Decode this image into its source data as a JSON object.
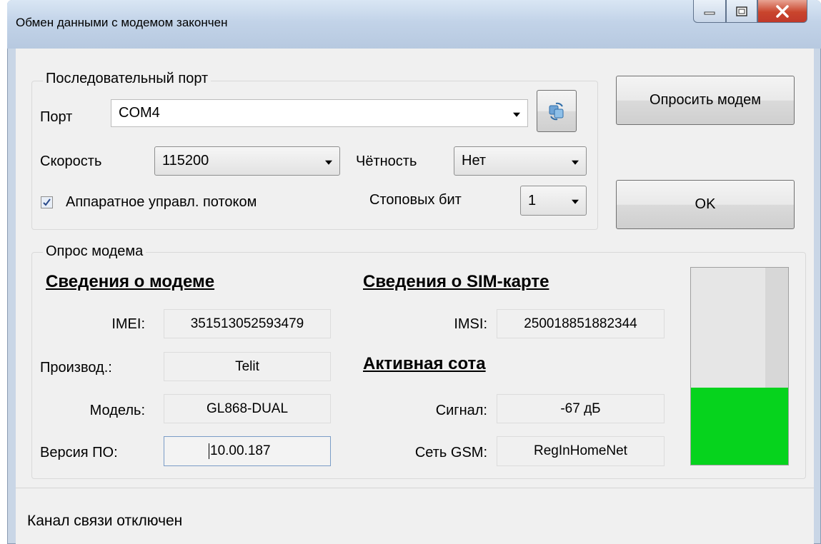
{
  "window": {
    "title": "Обмен данными с модемом закончен",
    "controls": {
      "minimize": "—",
      "maximize": "□",
      "close": "X"
    }
  },
  "serial": {
    "legend": "Последовательный порт",
    "port_label": "Порт",
    "port_value": "COM4",
    "speed_label": "Скорость",
    "speed_value": "115200",
    "parity_label": "Чётность",
    "parity_value": "Нет",
    "flow_label": "Аппаратное управл. потоком",
    "flow_checked": true,
    "stopbits_label": "Стоповых бит",
    "stopbits_value": "1",
    "refresh_icon": "refresh-icon"
  },
  "buttons": {
    "query": "Опросить модем",
    "ok": "OK"
  },
  "poll": {
    "legend": "Опрос модема",
    "modem_heading": "Сведения о модеме",
    "sim_heading": "Сведения о SIM-карте",
    "cell_heading": "Активная сота",
    "imei_label": "IMEI:",
    "imei_value": "351513052593479",
    "maker_label": "Производ.:",
    "maker_value": "Telit",
    "model_label": "Модель:",
    "model_value": "GL868-DUAL",
    "fw_label": "Версия ПО:",
    "fw_value": "10.00.187",
    "imsi_label": "IMSI:",
    "imsi_value": "250018851882344",
    "signal_label": "Сигнал:",
    "signal_value": "-67 дБ",
    "network_label": "Сеть GSM:",
    "network_value": "RegInHomeNet",
    "signal_level_fraction": 0.39,
    "signal_color": "#06d31d"
  },
  "status": {
    "text": "Канал связи отключен"
  }
}
